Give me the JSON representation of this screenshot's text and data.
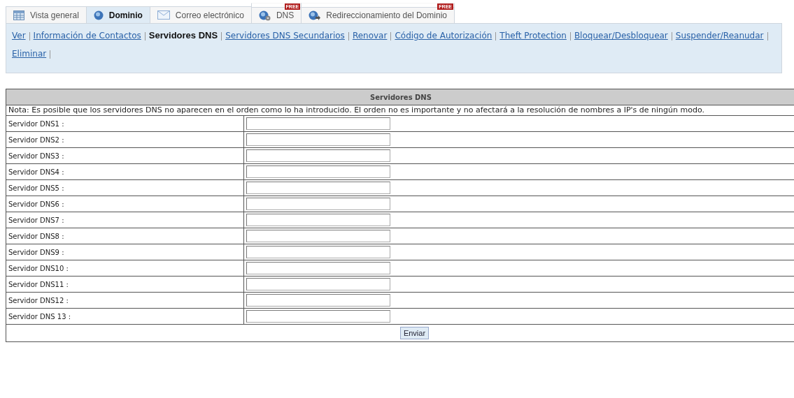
{
  "tabs": [
    {
      "label": "Vista general",
      "selected": false
    },
    {
      "label": "Dominio",
      "selected": true
    },
    {
      "label": "Correo electrónico",
      "selected": false
    },
    {
      "label": "DNS",
      "selected": false,
      "badge": "FREE"
    },
    {
      "label": "Redireccionamiento del Dominio",
      "selected": false,
      "badge": "FREE"
    }
  ],
  "subnav": [
    {
      "label": "Ver",
      "selected": false
    },
    {
      "label": "Información de Contactos",
      "selected": false
    },
    {
      "label": "Servidores DNS",
      "selected": true
    },
    {
      "label": "Servidores DNS Secundarios",
      "selected": false
    },
    {
      "label": "Renovar",
      "selected": false
    },
    {
      "label": "Código de Autorización",
      "selected": false
    },
    {
      "label": "Theft Protection",
      "selected": false
    },
    {
      "label": "Bloquear/Desbloquear",
      "selected": false
    },
    {
      "label": "Suspender/Reanudar",
      "selected": false
    },
    {
      "label": "Eliminar",
      "selected": false
    }
  ],
  "form": {
    "title": "Servidores DNS",
    "note": "Nota: Es posible que los servidores DNS no aparecen en el orden como lo ha introducido. El orden no es importante y no afectará a la resolución de nombres a IP's de ningún modo.",
    "rows": [
      {
        "label": "Servidor DNS1 :"
      },
      {
        "label": "Servidor DNS2 :"
      },
      {
        "label": "Servidor DNS3 :"
      },
      {
        "label": "Servidor DNS4 :"
      },
      {
        "label": "Servidor DNS5 :"
      },
      {
        "label": "Servidor DNS6 :"
      },
      {
        "label": "Servidor DNS7 :"
      },
      {
        "label": "Servidor DNS8 :"
      },
      {
        "label": "Servidor DNS9 :"
      },
      {
        "label": "Servidor DNS10 :"
      },
      {
        "label": "Servidor DNS11 :"
      },
      {
        "label": "Servidor DNS12 :"
      },
      {
        "label": "Servidor DNS 13 :"
      }
    ],
    "submit": "Enviar"
  }
}
